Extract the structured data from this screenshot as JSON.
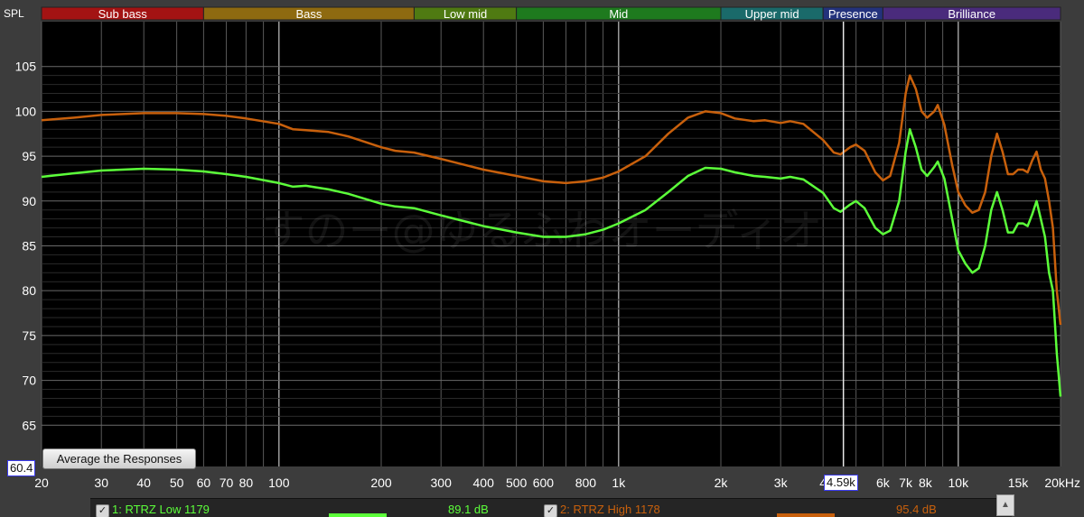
{
  "colors": {
    "background": "#000000",
    "frame": "#3c3c3c",
    "grid": "#5a5a5a",
    "cursor": "#e8e8e8",
    "series1": "#5cff3a",
    "series2": "#c8600c"
  },
  "bands": [
    {
      "label": "Sub bass",
      "from": 20,
      "to": 60,
      "color": "#a31313"
    },
    {
      "label": "Bass",
      "from": 60,
      "to": 250,
      "color": "#8e6a10"
    },
    {
      "label": "Low mid",
      "from": 250,
      "to": 500,
      "color": "#4f7a12"
    },
    {
      "label": "Mid",
      "from": 500,
      "to": 2000,
      "color": "#1e7a1e"
    },
    {
      "label": "Upper mid",
      "from": 2000,
      "to": 4000,
      "color": "#1a6a6a"
    },
    {
      "label": "Presence",
      "from": 4000,
      "to": 6000,
      "color": "#23327c"
    },
    {
      "label": "Brilliance",
      "from": 6000,
      "to": 20000,
      "color": "#4a2b7c"
    }
  ],
  "chart_data": {
    "type": "line",
    "ylabel": "SPL",
    "x_scale": "log",
    "xlim": [
      20,
      20000
    ],
    "ylim": [
      60.4,
      110
    ],
    "grid": true,
    "x_ticks": [
      {
        "v": 20,
        "t": "20"
      },
      {
        "v": 30,
        "t": "30"
      },
      {
        "v": 40,
        "t": "40"
      },
      {
        "v": 50,
        "t": "50"
      },
      {
        "v": 60,
        "t": "60"
      },
      {
        "v": 70,
        "t": "70"
      },
      {
        "v": 80,
        "t": "80"
      },
      {
        "v": 100,
        "t": "100"
      },
      {
        "v": 200,
        "t": "200"
      },
      {
        "v": 300,
        "t": "300"
      },
      {
        "v": 400,
        "t": "400"
      },
      {
        "v": 500,
        "t": "500"
      },
      {
        "v": 600,
        "t": "600"
      },
      {
        "v": 800,
        "t": "800"
      },
      {
        "v": 1000,
        "t": "1k"
      },
      {
        "v": 2000,
        "t": "2k"
      },
      {
        "v": 3000,
        "t": "3k"
      },
      {
        "v": 4000,
        "t": "4"
      },
      {
        "v": 6000,
        "t": "6k"
      },
      {
        "v": 7000,
        "t": "7k"
      },
      {
        "v": 8000,
        "t": "8k"
      },
      {
        "v": 10000,
        "t": "10k"
      },
      {
        "v": 15000,
        "t": "15k"
      },
      {
        "v": 20000,
        "t": "20kHz"
      }
    ],
    "y_ticks": [
      65,
      70,
      75,
      80,
      85,
      90,
      95,
      100,
      105
    ],
    "cursor_freq": 4590,
    "series": [
      {
        "name": "1: RTRZ Low 1179",
        "color": "#5cff3a",
        "points": [
          [
            20,
            92.7
          ],
          [
            25,
            93.1
          ],
          [
            30,
            93.4
          ],
          [
            40,
            93.6
          ],
          [
            50,
            93.5
          ],
          [
            60,
            93.3
          ],
          [
            70,
            93.0
          ],
          [
            80,
            92.7
          ],
          [
            100,
            92.0
          ],
          [
            110,
            91.6
          ],
          [
            120,
            91.7
          ],
          [
            140,
            91.3
          ],
          [
            160,
            90.8
          ],
          [
            200,
            89.7
          ],
          [
            220,
            89.4
          ],
          [
            250,
            89.2
          ],
          [
            300,
            88.4
          ],
          [
            400,
            87.2
          ],
          [
            500,
            86.5
          ],
          [
            600,
            86.0
          ],
          [
            700,
            86.0
          ],
          [
            800,
            86.3
          ],
          [
            900,
            86.8
          ],
          [
            1000,
            87.5
          ],
          [
            1200,
            89.0
          ],
          [
            1400,
            91.0
          ],
          [
            1600,
            92.8
          ],
          [
            1800,
            93.7
          ],
          [
            2000,
            93.6
          ],
          [
            2200,
            93.2
          ],
          [
            2500,
            92.8
          ],
          [
            2700,
            92.7
          ],
          [
            3000,
            92.5
          ],
          [
            3200,
            92.7
          ],
          [
            3500,
            92.4
          ],
          [
            4000,
            90.9
          ],
          [
            4300,
            89.2
          ],
          [
            4500,
            88.8
          ],
          [
            4800,
            89.6
          ],
          [
            5000,
            90.0
          ],
          [
            5300,
            89.2
          ],
          [
            5700,
            87.0
          ],
          [
            6000,
            86.3
          ],
          [
            6300,
            86.7
          ],
          [
            6700,
            90.0
          ],
          [
            7000,
            95.5
          ],
          [
            7200,
            98.0
          ],
          [
            7500,
            96.0
          ],
          [
            7800,
            93.5
          ],
          [
            8100,
            92.8
          ],
          [
            8500,
            93.8
          ],
          [
            8700,
            94.4
          ],
          [
            9100,
            92.5
          ],
          [
            9600,
            88.0
          ],
          [
            10000,
            84.5
          ],
          [
            10500,
            83.0
          ],
          [
            11000,
            82.0
          ],
          [
            11500,
            82.5
          ],
          [
            12000,
            85.0
          ],
          [
            12500,
            89.0
          ],
          [
            13000,
            91.0
          ],
          [
            13500,
            89.0
          ],
          [
            14000,
            86.5
          ],
          [
            14500,
            86.5
          ],
          [
            15000,
            87.5
          ],
          [
            15500,
            87.5
          ],
          [
            16000,
            87.2
          ],
          [
            16500,
            88.5
          ],
          [
            17000,
            90.0
          ],
          [
            17500,
            88.0
          ],
          [
            18000,
            86.0
          ],
          [
            18500,
            82.0
          ],
          [
            19000,
            80.0
          ],
          [
            19500,
            73.0
          ],
          [
            20000,
            68.2
          ]
        ]
      },
      {
        "name": "2: RTRZ High 1178",
        "color": "#c8600c",
        "points": [
          [
            20,
            99.0
          ],
          [
            25,
            99.3
          ],
          [
            30,
            99.6
          ],
          [
            40,
            99.8
          ],
          [
            50,
            99.8
          ],
          [
            60,
            99.7
          ],
          [
            70,
            99.5
          ],
          [
            80,
            99.2
          ],
          [
            100,
            98.6
          ],
          [
            110,
            98.0
          ],
          [
            120,
            97.9
          ],
          [
            140,
            97.7
          ],
          [
            160,
            97.2
          ],
          [
            200,
            96.0
          ],
          [
            220,
            95.6
          ],
          [
            250,
            95.4
          ],
          [
            300,
            94.7
          ],
          [
            400,
            93.5
          ],
          [
            500,
            92.8
          ],
          [
            600,
            92.2
          ],
          [
            700,
            92.0
          ],
          [
            800,
            92.2
          ],
          [
            900,
            92.6
          ],
          [
            1000,
            93.3
          ],
          [
            1200,
            95.0
          ],
          [
            1400,
            97.5
          ],
          [
            1600,
            99.3
          ],
          [
            1800,
            100.0
          ],
          [
            2000,
            99.8
          ],
          [
            2200,
            99.2
          ],
          [
            2500,
            98.9
          ],
          [
            2700,
            99.0
          ],
          [
            3000,
            98.7
          ],
          [
            3200,
            98.9
          ],
          [
            3500,
            98.6
          ],
          [
            4000,
            96.8
          ],
          [
            4300,
            95.4
          ],
          [
            4500,
            95.2
          ],
          [
            4800,
            96.0
          ],
          [
            5000,
            96.3
          ],
          [
            5300,
            95.6
          ],
          [
            5700,
            93.2
          ],
          [
            6000,
            92.3
          ],
          [
            6300,
            92.8
          ],
          [
            6700,
            96.5
          ],
          [
            7000,
            102.0
          ],
          [
            7200,
            104.0
          ],
          [
            7500,
            102.5
          ],
          [
            7800,
            100.0
          ],
          [
            8100,
            99.3
          ],
          [
            8500,
            100.0
          ],
          [
            8700,
            100.7
          ],
          [
            9100,
            98.5
          ],
          [
            9600,
            94.0
          ],
          [
            10000,
            91.0
          ],
          [
            10500,
            89.5
          ],
          [
            11000,
            88.7
          ],
          [
            11500,
            89.0
          ],
          [
            12000,
            91.0
          ],
          [
            12500,
            95.0
          ],
          [
            13000,
            97.5
          ],
          [
            13500,
            95.5
          ],
          [
            14000,
            93.0
          ],
          [
            14500,
            93.0
          ],
          [
            15000,
            93.5
          ],
          [
            15500,
            93.5
          ],
          [
            16000,
            93.2
          ],
          [
            16500,
            94.5
          ],
          [
            17000,
            95.5
          ],
          [
            17500,
            93.5
          ],
          [
            18000,
            92.5
          ],
          [
            18500,
            90.0
          ],
          [
            19000,
            87.0
          ],
          [
            19500,
            80.0
          ],
          [
            20000,
            76.2
          ]
        ]
      }
    ]
  },
  "labels": {
    "spl_axis": "SPL",
    "watermark": "すのー@ゆるふわオーディオ",
    "average_button": "Average the Responses",
    "spl_readout": "60.4",
    "freq_readout": "4.59k"
  },
  "legend": {
    "items": [
      {
        "name": "1: RTRZ Low 1179",
        "value": "89.1 dB",
        "color": "#5cff3a"
      },
      {
        "name": "2: RTRZ High 1178",
        "value": "95.4 dB",
        "color": "#c8600c"
      }
    ]
  }
}
